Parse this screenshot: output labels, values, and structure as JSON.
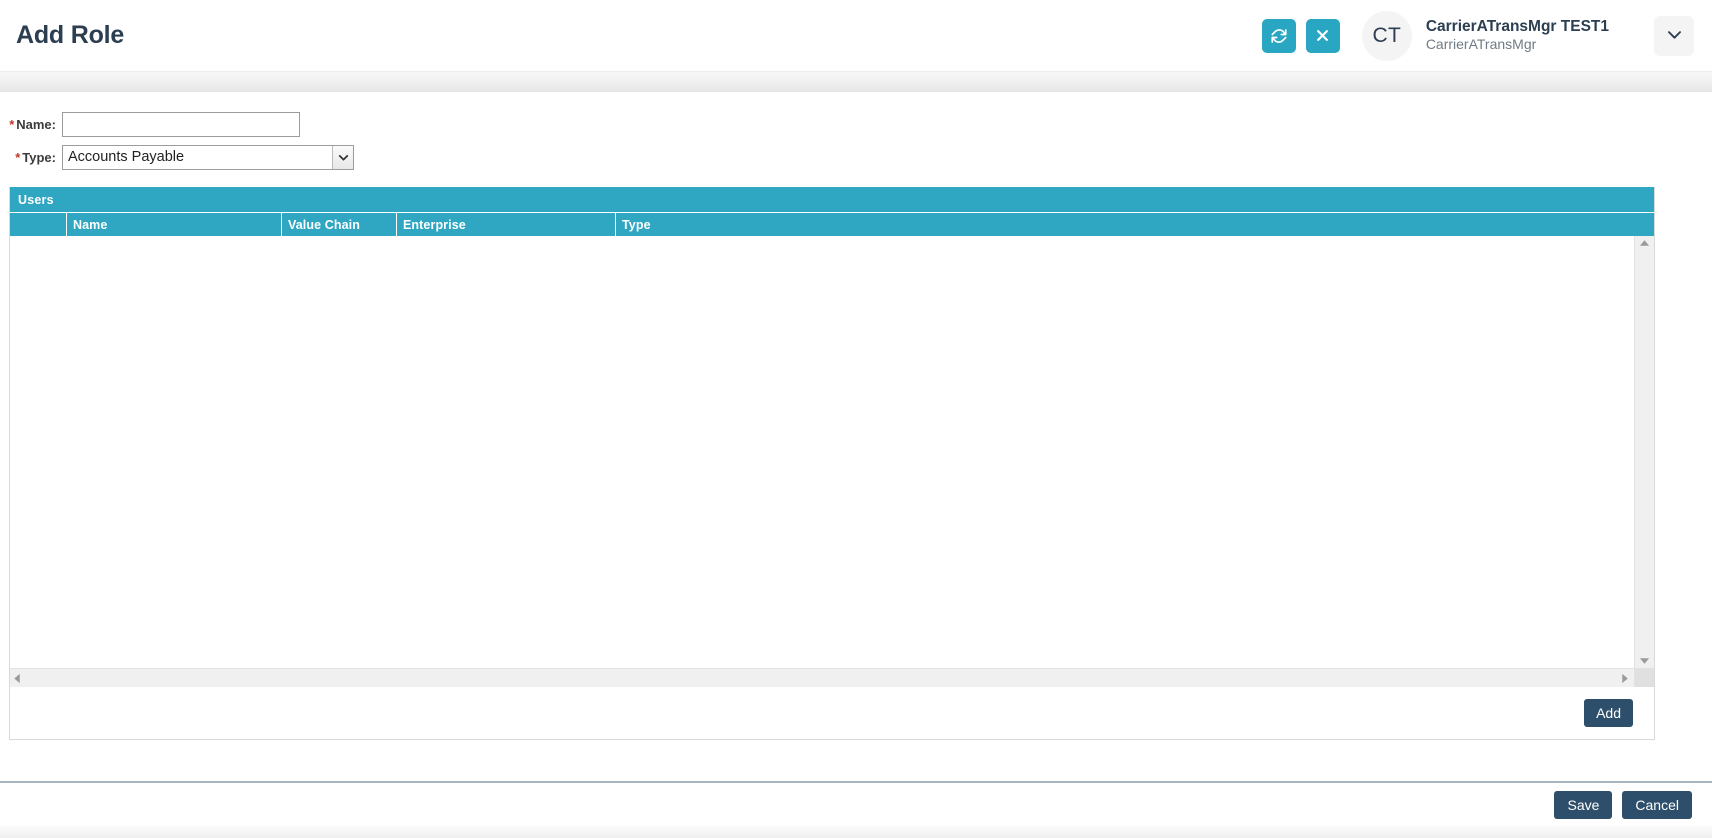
{
  "header": {
    "title": "Add Role",
    "refresh_icon": "refresh-icon",
    "close_icon": "close-icon",
    "avatar_initials": "CT",
    "user_name": "CarrierATransMgr TEST1",
    "user_role": "CarrierATransMgr",
    "chevron_icon": "chevron-down-icon",
    "accent_teal": "#29a6c2",
    "title_color": "#2c3e50"
  },
  "form": {
    "name": {
      "label": "Name:",
      "required_marker": "*",
      "value": "",
      "placeholder": ""
    },
    "type": {
      "label": "Type:",
      "required_marker": "*",
      "selected": "Accounts Payable",
      "options": [
        "Accounts Payable"
      ]
    }
  },
  "users_panel": {
    "title": "Users",
    "panel_color": "#2fa7c3",
    "columns": [
      "",
      "Name",
      "Value Chain",
      "Enterprise",
      "Type"
    ],
    "rows": [],
    "add_label": "Add",
    "scroll": {
      "up_arrow": "caret-up-icon",
      "down_arrow": "caret-down-icon",
      "left_arrow": "caret-left-icon",
      "right_arrow": "caret-right-icon"
    }
  },
  "footer": {
    "save_label": "Save",
    "cancel_label": "Cancel",
    "button_color": "#2e4f6b"
  }
}
